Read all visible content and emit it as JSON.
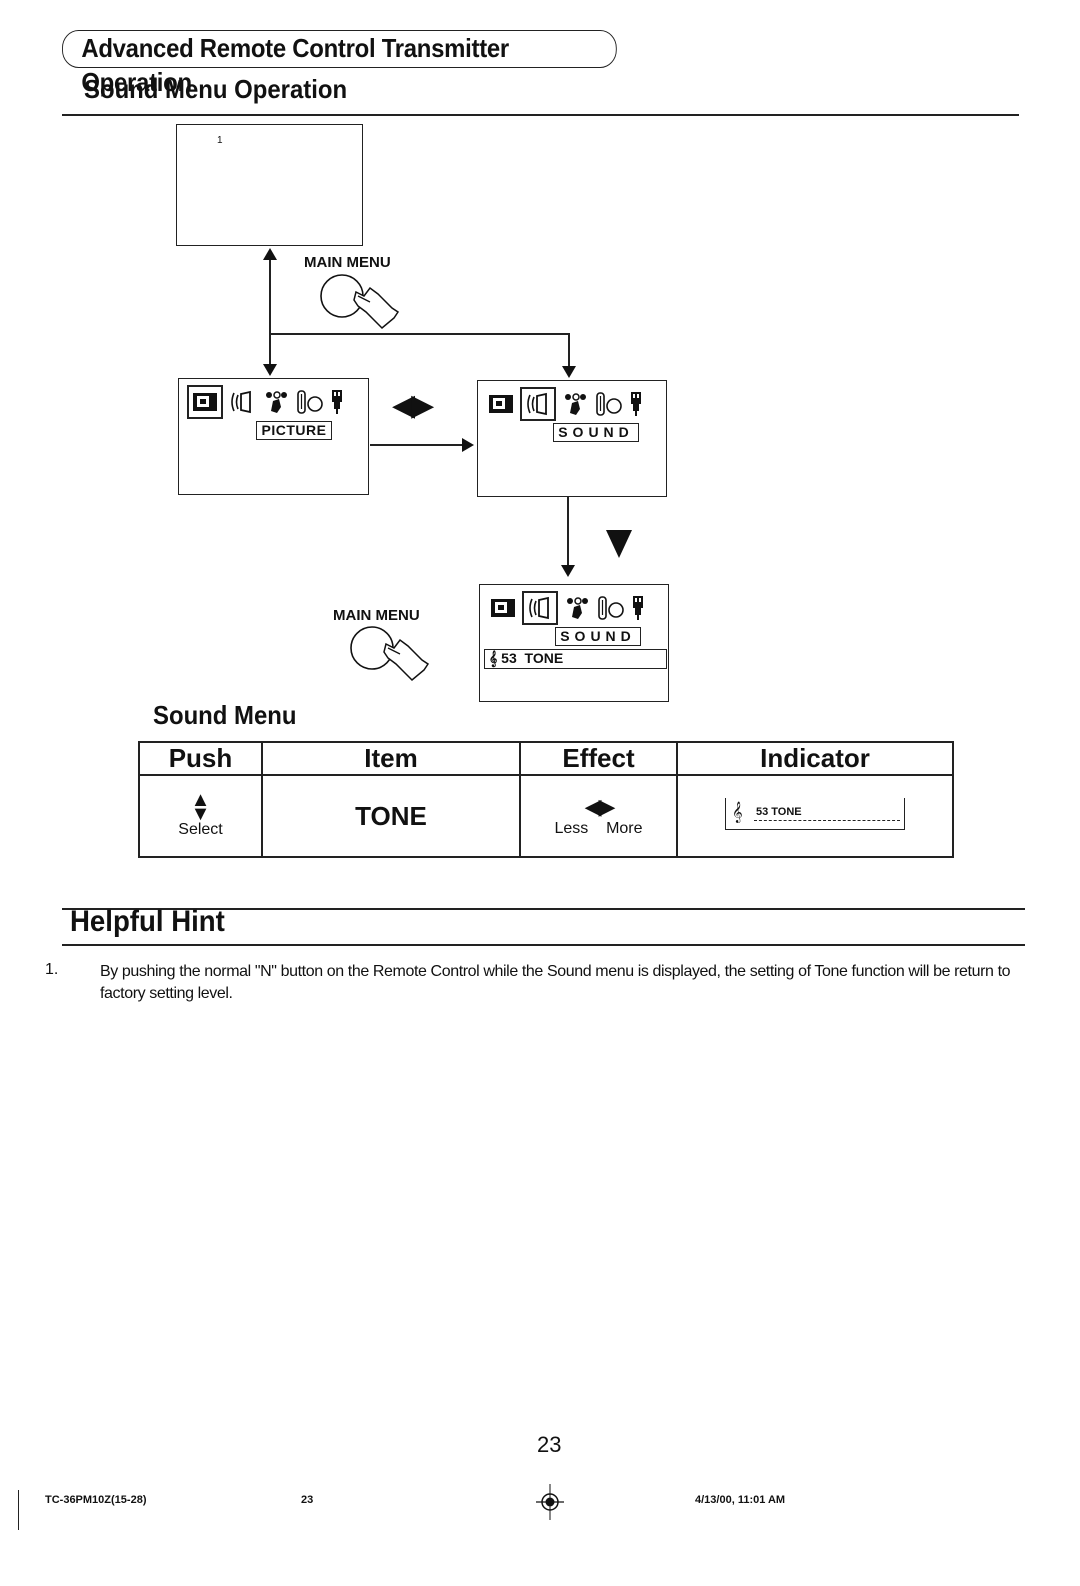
{
  "header": {
    "title": "Advanced Remote Control Transmitter Operation",
    "subtitle": "Sound Menu Operation"
  },
  "diagram": {
    "blank_screen_mark": "1",
    "main_menu_label_1": "MAIN MENU",
    "main_menu_label_2": "MAIN MENU",
    "picture_label": "PICTURE",
    "sound_label": "SOUND",
    "sound_label_2": "SOUND",
    "tone_row": "53  TONE",
    "lr_arrows": "◀▶",
    "icons": [
      "picture-icon",
      "sound-icon",
      "timer-icon",
      "setup-icon",
      "plug-icon"
    ]
  },
  "sound_menu": {
    "heading": "Sound Menu",
    "columns": [
      "Push",
      "Item",
      "Effect",
      "Indicator"
    ],
    "rows": [
      {
        "push_glyph": "▲▼",
        "push_label": "Select",
        "item": "TONE",
        "effect_glyph": "◀▶",
        "effect_less": "Less",
        "effect_more": "More",
        "indicator_text": "53 TONE",
        "indicator_value": 53
      }
    ]
  },
  "helpful_hint": {
    "heading": "Helpful Hint",
    "items": [
      {
        "number": "1.",
        "text": "By pushing the normal \"N\" button on the Remote Control while the Sound menu is displayed, the setting of Tone function will be return to factory setting level."
      }
    ]
  },
  "footer": {
    "page_number": "23",
    "doc_code": "TC-36PM10Z(15-28)",
    "doc_page": "23",
    "timestamp": "4/13/00, 11:01 AM"
  }
}
